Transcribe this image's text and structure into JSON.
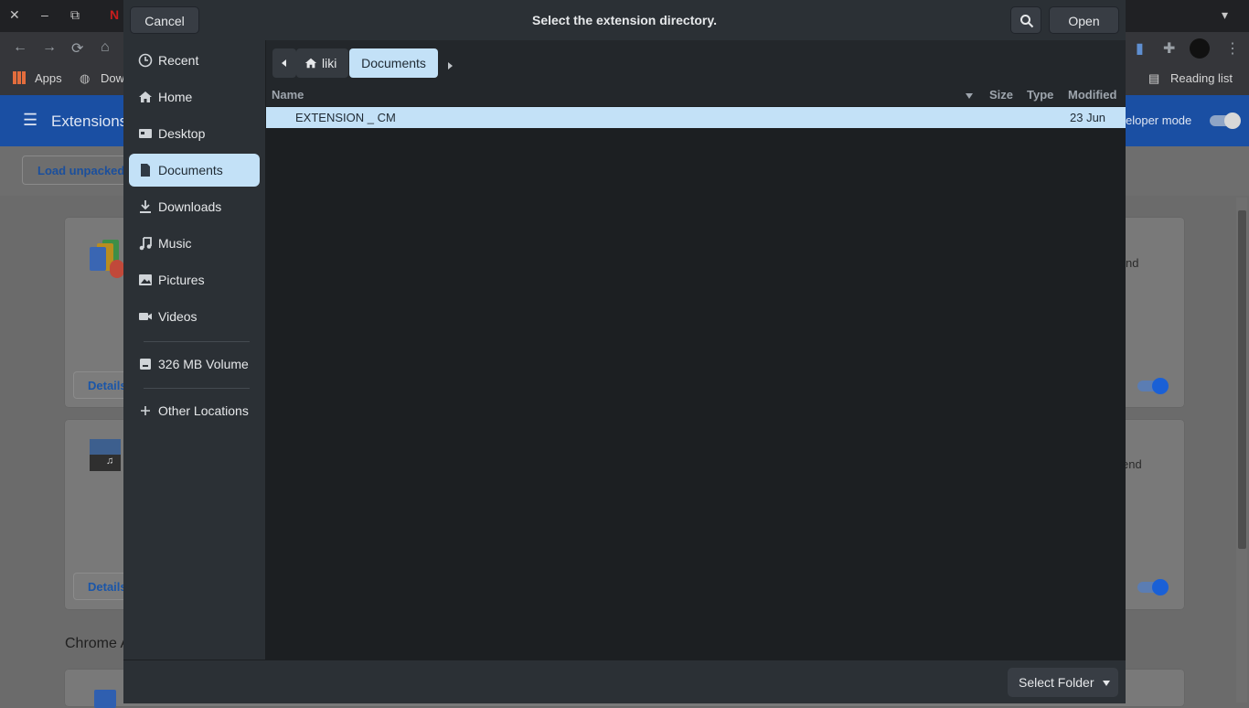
{
  "background": {
    "bookmarks": [
      {
        "label": "Apps"
      },
      {
        "label": "Dow"
      },
      {
        "label": "Reading list"
      }
    ],
    "header_title": "Extensions",
    "dev_mode_label": "eloper mode",
    "load_unpacked_label": "Load unpacked",
    "details_label": "Details",
    "card_text_1": "nd",
    "card_text_2": "end",
    "section_title": "Chrome A"
  },
  "dialog": {
    "title": "Select the extension directory.",
    "cancel_label": "Cancel",
    "open_label": "Open",
    "sidebar": {
      "items": [
        {
          "label": "Recent",
          "icon": "clock-icon"
        },
        {
          "label": "Home",
          "icon": "home-icon"
        },
        {
          "label": "Desktop",
          "icon": "desktop-icon"
        },
        {
          "label": "Documents",
          "icon": "document-icon",
          "active": true
        },
        {
          "label": "Downloads",
          "icon": "download-icon"
        },
        {
          "label": "Music",
          "icon": "music-icon"
        },
        {
          "label": "Pictures",
          "icon": "picture-icon"
        },
        {
          "label": "Videos",
          "icon": "video-icon"
        }
      ],
      "volume_label": "326 MB Volume",
      "other_locations_label": "Other Locations"
    },
    "path": {
      "home": "liki",
      "current": "Documents"
    },
    "columns": {
      "name": "Name",
      "size": "Size",
      "type": "Type",
      "modified": "Modified"
    },
    "files": [
      {
        "name": "EXTENSION _ CM",
        "size": "",
        "type": "",
        "modified": "23 Jun"
      }
    ],
    "filter_label": "Select Folder"
  },
  "colors": {
    "accent_selection": "#c3e1f7",
    "dialog_bg": "#202428"
  }
}
